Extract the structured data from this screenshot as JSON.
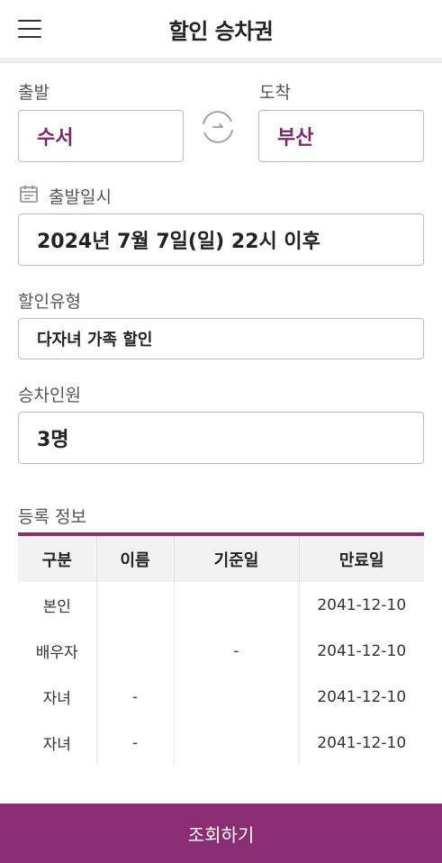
{
  "header": {
    "title": "할인 승차권",
    "menu_icon": "menu-icon"
  },
  "route": {
    "departure_label": "출발",
    "arrival_label": "도착",
    "departure_station": "수서",
    "arrival_station": "부산",
    "swap_icon": "swap-icon"
  },
  "departure_datetime": {
    "label": "출발일시",
    "icon": "calendar-icon",
    "value": "2024년 7월 7일(일) 22시 이후"
  },
  "discount_type": {
    "label": "할인유형",
    "value": "다자녀 가족 할인"
  },
  "passengers": {
    "label": "승차인원",
    "value": "3명"
  },
  "registration": {
    "title": "등록 정보",
    "columns": [
      "구분",
      "이름",
      "기준일",
      "만료일"
    ],
    "rows": [
      [
        "본인",
        "",
        "",
        "2041-12-10"
      ],
      [
        "배우자",
        "",
        "-",
        "2041-12-10"
      ],
      [
        "자녀",
        "-",
        "",
        "2041-12-10"
      ],
      [
        "자녀",
        "-",
        "",
        "2041-12-10"
      ]
    ]
  },
  "search_button": "조회하기",
  "colors": {
    "brand": "#8a2e73",
    "station_text": "#7a2a6a"
  }
}
